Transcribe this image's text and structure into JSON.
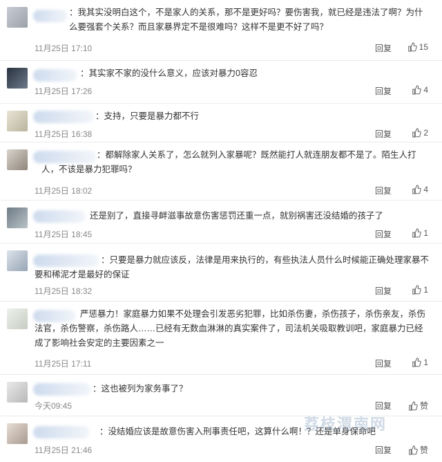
{
  "comments": [
    {
      "text": "：我其实没明白这个，不是家人的关系，那不是更好吗？要伤害我，就已经是违法了啊？为什么要强套个关系？而且家暴界定不是很难吗？这样不是更不好了吗？",
      "time": "11月25日 17:10",
      "reply": "回复",
      "likes": "15"
    },
    {
      "text": "：其实家不家的没什么意义，应该对暴力0容忍",
      "time": "11月25日 17:26",
      "reply": "回复",
      "likes": "4"
    },
    {
      "text": "：支持，只要是暴力都不行",
      "time": "11月25日 16:38",
      "reply": "回复",
      "likes": "2"
    },
    {
      "text": "：都解除家人关系了，怎么就列入家暴呢？既然能打人就连朋友都不是了。陌生人打人，不该是暴力犯罪吗？",
      "time": "11月25日 18:02",
      "reply": "回复",
      "likes": "4"
    },
    {
      "text": "还是别了，直接寻衅滋事故意伤害惩罚还重一点，就别祸害还没结婚的孩子了",
      "time": "11月25日 18:45",
      "reply": "回复",
      "likes": "1"
    },
    {
      "text": "：只要是暴力就应该反，法律是用来执行的，有些执法人员什么时候能正确处理家暴不要和稀泥才是最好的保证",
      "time": "11月25日 18:32",
      "reply": "回复",
      "likes": "1"
    },
    {
      "text": "严惩暴力！家庭暴力如果不处理会引发恶劣犯罪，比如杀伤妻，杀伤孩子，杀伤亲友，杀伤法官，杀伤警察，杀伤路人……已经有无数血淋淋的真实案件了，司法机关吸取教训吧，家庭暴力已经成了影响社会安定的主要因素之一",
      "time": "11月25日 17:11",
      "reply": "回复",
      "likes": "1"
    },
    {
      "text": "：这也被列为家务事了？",
      "time": "今天09:45",
      "reply": "回复",
      "likes": "赞"
    },
    {
      "text": "：没结婚应该是故意伤害入刑事责任吧，这算什么啊！？还是单身保命吧",
      "time": "11月25日 21:46",
      "reply": "回复",
      "likes": "赞"
    }
  ],
  "watermark": "荔枝渭南网"
}
